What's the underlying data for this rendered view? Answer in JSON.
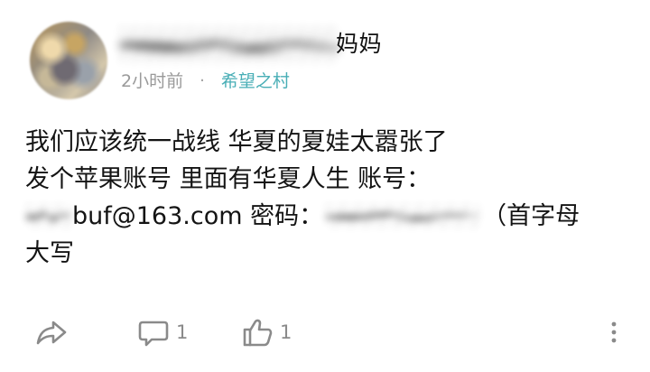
{
  "post": {
    "author": {
      "name_visible_suffix": "妈妈"
    },
    "meta": {
      "time": "2小时前",
      "separator": "·",
      "group": "希望之村"
    },
    "content": {
      "line1": "我们应该统一战线  华夏的夏娃太嚣张了",
      "line2": "发个苹果账号  里面有华夏人生  账号：",
      "line3_account_suffix": "buf@163.com",
      "line3_password_label": "密码：",
      "line3_tail": "（首字母",
      "line4": "大写"
    },
    "actions": {
      "share_icon": "share-icon",
      "comment_icon": "comment-icon",
      "comment_count": "1",
      "like_icon": "thumbs-up-icon",
      "like_count": "1",
      "more_icon": "more-vertical-icon"
    }
  },
  "colors": {
    "group_link": "#48aeb6",
    "meta_gray": "#9a9a9a",
    "action_gray": "#858585"
  }
}
